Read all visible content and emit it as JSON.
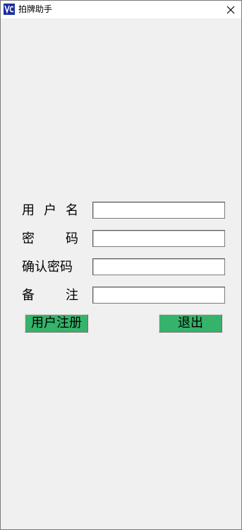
{
  "window": {
    "title": "拍牌助手",
    "app_icon": "app-logo-icon",
    "close_icon": "close-icon"
  },
  "form": {
    "username_label": [
      "用",
      "户",
      "名"
    ],
    "password_label": [
      "密",
      "码"
    ],
    "confirm_label": [
      "确认密码"
    ],
    "remark_label": [
      "备",
      "注"
    ],
    "username_value": "",
    "password_value": "",
    "confirm_value": "",
    "remark_value": ""
  },
  "buttons": {
    "register_label": "用户注册",
    "exit_label": "退出",
    "color": "#36b36a"
  }
}
